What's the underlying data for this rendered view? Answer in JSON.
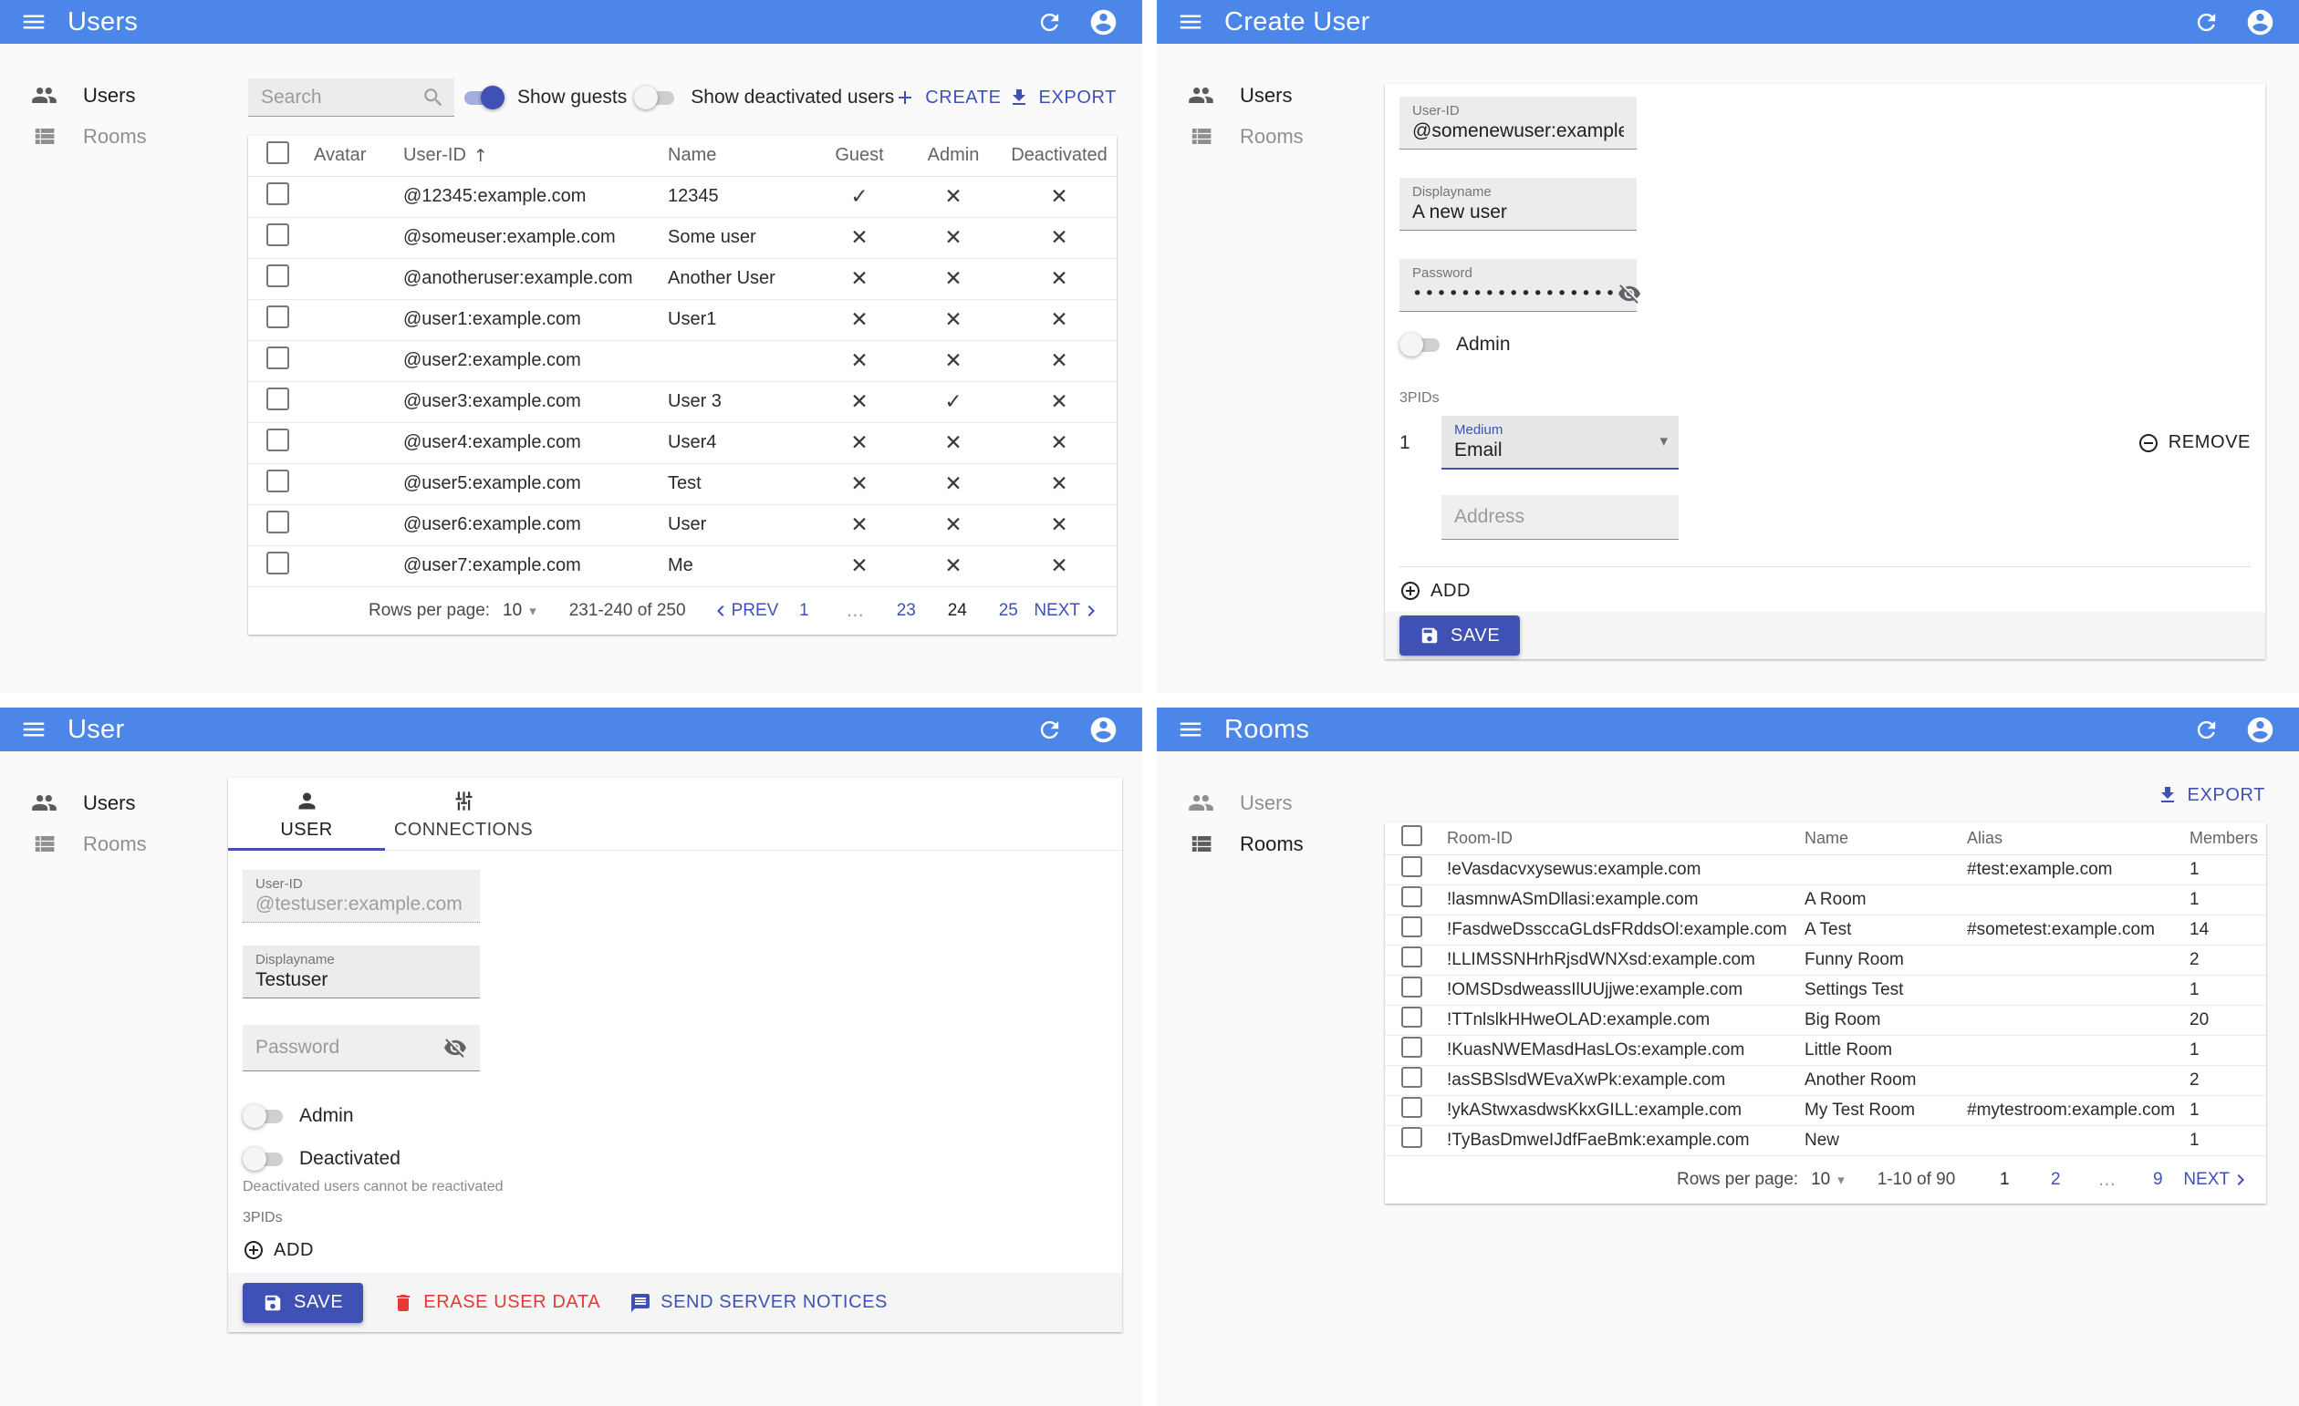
{
  "colors": {
    "appbar": "#4b86e8",
    "primary": "#3f51b5",
    "danger": "#e53935",
    "background": "#fafafa"
  },
  "menu": {
    "users_label": "Users",
    "rooms_label": "Rooms"
  },
  "users_list": {
    "title": "Users",
    "search_placeholder": "Search",
    "show_guests_label": "Show guests",
    "show_guests_on": true,
    "show_deactivated_label": "Show deactivated users",
    "show_deactivated_on": false,
    "create_label": "CREATE",
    "export_label": "EXPORT",
    "columns": {
      "avatar": "Avatar",
      "user_id": "User-ID",
      "name": "Name",
      "guest": "Guest",
      "admin": "Admin",
      "deactivated": "Deactivated"
    },
    "rows": [
      {
        "user_id": "@12345:example.com",
        "name": "12345",
        "guest": true,
        "admin": false,
        "deactivated": false
      },
      {
        "user_id": "@someuser:example.com",
        "name": "Some user",
        "guest": false,
        "admin": false,
        "deactivated": false
      },
      {
        "user_id": "@anotheruser:example.com",
        "name": "Another User",
        "guest": false,
        "admin": false,
        "deactivated": false
      },
      {
        "user_id": "@user1:example.com",
        "name": "User1",
        "guest": false,
        "admin": false,
        "deactivated": false
      },
      {
        "user_id": "@user2:example.com",
        "name": "",
        "guest": false,
        "admin": false,
        "deactivated": false
      },
      {
        "user_id": "@user3:example.com",
        "name": "User 3",
        "guest": false,
        "admin": true,
        "deactivated": false
      },
      {
        "user_id": "@user4:example.com",
        "name": "User4",
        "guest": false,
        "admin": false,
        "deactivated": false
      },
      {
        "user_id": "@user5:example.com",
        "name": "Test",
        "guest": false,
        "admin": false,
        "deactivated": false
      },
      {
        "user_id": "@user6:example.com",
        "name": "User",
        "guest": false,
        "admin": false,
        "deactivated": false
      },
      {
        "user_id": "@user7:example.com",
        "name": "Me",
        "guest": false,
        "admin": false,
        "deactivated": false
      }
    ],
    "pagination": {
      "rows_per_page_label": "Rows per page:",
      "rows_per_page": "10",
      "range": "231-240 of 250",
      "prev_label": "PREV",
      "next_label": "NEXT",
      "pages": [
        {
          "label": "1",
          "current": false
        },
        {
          "label": "…",
          "ellipsis": true
        },
        {
          "label": "23",
          "current": false
        },
        {
          "label": "24",
          "current": true
        },
        {
          "label": "25",
          "current": false
        }
      ]
    }
  },
  "create_user": {
    "title": "Create User",
    "user_id_label": "User-ID",
    "user_id_value": "@somenewuser:example.com",
    "displayname_label": "Displayname",
    "displayname_value": "A new user",
    "password_label": "Password",
    "password_masked": "•••••••••••••••••",
    "admin_label": "Admin",
    "admin_on": false,
    "threepids_label": "3PIDs",
    "threepid_index": "1",
    "medium_label": "Medium",
    "medium_value": "Email",
    "remove_label": "REMOVE",
    "address_placeholder": "Address",
    "add_label": "ADD",
    "save_label": "SAVE"
  },
  "user_edit": {
    "title": "User",
    "tab_user": "USER",
    "tab_connections": "CONNECTIONS",
    "user_id_label": "User-ID",
    "user_id_value": "@testuser:example.com",
    "displayname_label": "Displayname",
    "displayname_value": "Testuser",
    "password_placeholder": "Password",
    "admin_label": "Admin",
    "admin_on": false,
    "deactivated_label": "Deactivated",
    "deactivated_on": false,
    "deactivated_note": "Deactivated users cannot be reactivated",
    "threepids_label": "3PIDs",
    "add_label": "ADD",
    "save_label": "SAVE",
    "erase_label": "ERASE USER DATA",
    "notices_label": "SEND SERVER NOTICES"
  },
  "rooms_list": {
    "title": "Rooms",
    "export_label": "EXPORT",
    "columns": {
      "room_id": "Room-ID",
      "name": "Name",
      "alias": "Alias",
      "members": "Members"
    },
    "rows": [
      {
        "room_id": "!eVasdacvxysewus:example.com",
        "name": "",
        "alias": "#test:example.com",
        "members": "1"
      },
      {
        "room_id": "!lasmnwASmDllasi:example.com",
        "name": "A Room",
        "alias": "",
        "members": "1"
      },
      {
        "room_id": "!FasdweDssccaGLdsFRddsOl:example.com",
        "name": "A Test",
        "alias": "#sometest:example.com",
        "members": "14"
      },
      {
        "room_id": "!LLIMSSNHrhRjsdWNXsd:example.com",
        "name": "Funny Room",
        "alias": "",
        "members": "2"
      },
      {
        "room_id": "!OMSDsdweassIlUUjjwe:example.com",
        "name": "Settings Test",
        "alias": "",
        "members": "1"
      },
      {
        "room_id": "!TTnlslkHHweOLAD:example.com",
        "name": "Big Room",
        "alias": "",
        "members": "20"
      },
      {
        "room_id": "!KuasNWEMasdHasLOs:example.com",
        "name": "Little Room",
        "alias": "",
        "members": "1"
      },
      {
        "room_id": "!asSBSlsdWEvaXwPk:example.com",
        "name": "Another Room",
        "alias": "",
        "members": "2"
      },
      {
        "room_id": "!ykAStwxasdwsKkxGILL:example.com",
        "name": "My Test Room",
        "alias": "#mytestroom:example.com",
        "members": "1"
      },
      {
        "room_id": "!TyBasDmweIJdfFaeBmk:example.com",
        "name": "New",
        "alias": "",
        "members": "1"
      }
    ],
    "pagination": {
      "rows_per_page_label": "Rows per page:",
      "rows_per_page": "10",
      "range": "1-10 of 90",
      "next_label": "NEXT",
      "pages": [
        {
          "label": "1",
          "current": true
        },
        {
          "label": "2",
          "current": false
        },
        {
          "label": "…",
          "ellipsis": true
        },
        {
          "label": "9",
          "current": false
        }
      ]
    }
  }
}
